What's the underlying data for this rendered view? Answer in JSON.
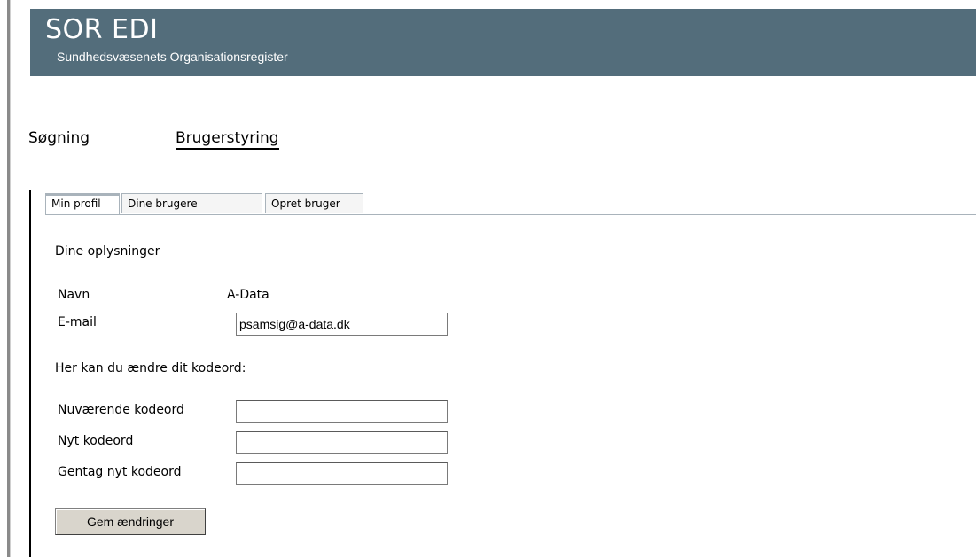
{
  "header": {
    "title": "SOR EDI",
    "subtitle": "Sundhedsvæsenets Organisationsregister"
  },
  "nav": {
    "items": [
      {
        "label": "Søgning"
      },
      {
        "label": "Brugerstyring",
        "active": true
      }
    ]
  },
  "tabs": [
    {
      "label": "Min profil",
      "active": true
    },
    {
      "label": "Dine brugere"
    },
    {
      "label": "Opret bruger"
    }
  ],
  "profile": {
    "section_title": "Dine oplysninger",
    "name_label": "Navn",
    "name_value": "A-Data",
    "email_label": "E-mail",
    "email_value": "psamsig@a-data.dk"
  },
  "password": {
    "intro": "Her kan du ændre dit kodeord:",
    "current_label": "Nuværende kodeord",
    "current_value": "",
    "new_label": "Nyt kodeord",
    "new_value": "",
    "repeat_label": "Gentag nyt kodeord",
    "repeat_value": ""
  },
  "actions": {
    "save_label": "Gem ændringer"
  },
  "colors": {
    "banner": "#536d7b",
    "active_tab_accent": "#f0a030"
  }
}
